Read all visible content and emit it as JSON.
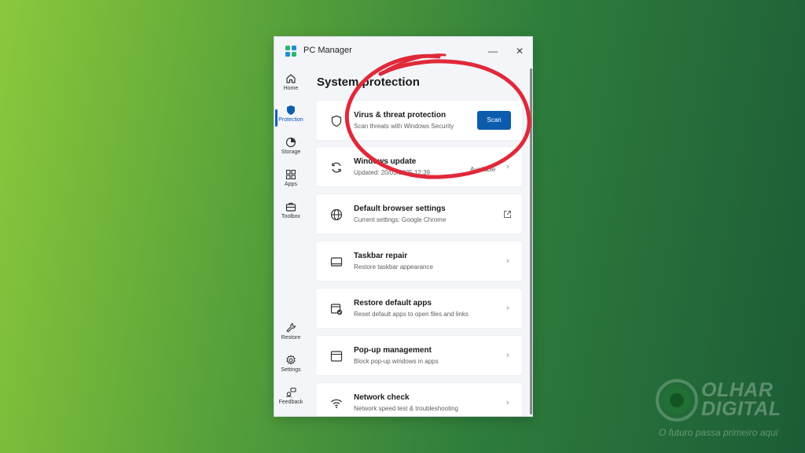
{
  "window": {
    "title": "PC Manager",
    "minimize_glyph": "—",
    "close_glyph": "✕"
  },
  "sidebar": {
    "items": [
      {
        "label": "Home",
        "icon": "home-icon",
        "active": false
      },
      {
        "label": "Protection",
        "icon": "shield-icon",
        "active": true
      },
      {
        "label": "Storage",
        "icon": "storage-pie-icon",
        "active": false
      },
      {
        "label": "Apps",
        "icon": "apps-grid-icon",
        "active": false
      },
      {
        "label": "Toolbox",
        "icon": "toolbox-icon",
        "active": false
      }
    ],
    "bottom_items": [
      {
        "label": "Restore",
        "icon": "wrench-icon"
      },
      {
        "label": "Settings",
        "icon": "gear-icon"
      },
      {
        "label": "Feedback",
        "icon": "feedback-icon"
      }
    ]
  },
  "main": {
    "title": "System protection",
    "cards": [
      {
        "title": "Virus & threat protection",
        "subtitle": "Scan threats with Windows Security",
        "action": "Scan",
        "icon": "shield-outline-icon"
      },
      {
        "title": "Windows update",
        "subtitle": "Updated: 20/03/2025 12:39",
        "status": "Available",
        "icon": "sync-icon"
      },
      {
        "title": "Default browser settings",
        "subtitle": "Current settings: Google Chrome",
        "icon": "globe-icon"
      },
      {
        "title": "Taskbar repair",
        "subtitle": "Restore taskbar appearance",
        "icon": "taskbar-icon"
      },
      {
        "title": "Restore default apps",
        "subtitle": "Reset default apps to open files and links",
        "icon": "default-apps-icon"
      },
      {
        "title": "Pop-up management",
        "subtitle": "Block pop-up windows in apps",
        "icon": "popup-window-icon"
      },
      {
        "title": "Network check",
        "subtitle": "Network speed test & troubleshooting",
        "icon": "wifi-icon"
      }
    ],
    "chevron_glyph": "›"
  },
  "watermark": {
    "brand": "OLHAR DIGITAL",
    "tagline": "O futuro passa primeiro aqui"
  },
  "colors": {
    "accent": "#0b5cad",
    "annotation": "#e0293a",
    "background_start": "#8bc83b",
    "background_end": "#1c5c36"
  }
}
